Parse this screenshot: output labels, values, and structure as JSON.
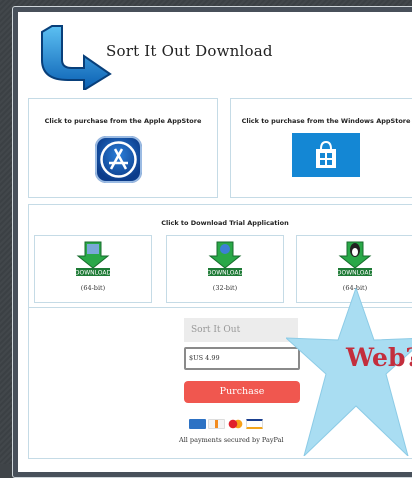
{
  "header": {
    "title": "Sort It Out Download",
    "logo_icon": "blue-curved-arrow-icon"
  },
  "stores": [
    {
      "label": "Click to purchase from the Apple AppStore",
      "icon": "app-store-icon"
    },
    {
      "label": "Click to purchase from the Windows AppStore",
      "icon": "windows-store-icon"
    }
  ],
  "trial": {
    "label": "Click to Download Trial Application",
    "downloads": [
      {
        "caption": "(64-bit)",
        "icon": "mac-download-icon",
        "badge": "DOWNLOAD"
      },
      {
        "caption": "(32-bit)",
        "icon": "windows-download-icon",
        "badge": "DOWNLOAD"
      },
      {
        "caption": "(64-bit)",
        "icon": "linux-download-icon",
        "badge": "DOWNLOAD"
      }
    ]
  },
  "purchase": {
    "product_name": "Sort It Out",
    "price": "$US 4.99",
    "button_label": "Purchase",
    "secured_text": "All payments secured by PayPal",
    "cards": [
      "amex",
      "discover",
      "mastercard",
      "visa"
    ]
  },
  "overlay": {
    "label": "Web?",
    "color": "#c32e3d",
    "star_color": "#a9ddf2"
  }
}
